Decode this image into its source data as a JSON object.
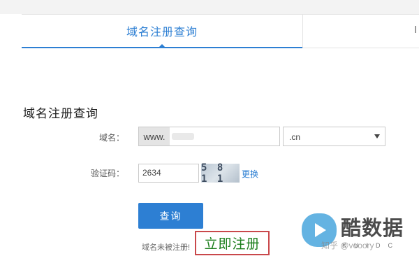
{
  "tabs": {
    "active_label": "域名注册查询",
    "second_label": ""
  },
  "form": {
    "title": "域名注册查询",
    "domain_label": "域名：",
    "domain_prefix": "www.",
    "domain_value": "",
    "suffix_value": ".cn",
    "captcha_label": "验证码：",
    "captcha_value": "2634",
    "captcha_image_text": "5811",
    "refresh_label": "更换",
    "query_button": "查询",
    "hint_text": "域名未被注册!",
    "register_label": "立即注册"
  },
  "watermark": {
    "brand": "酷数据",
    "sub": "KUIDC",
    "source": "知乎 @vooory"
  },
  "colors": {
    "accent": "#2d7fd3",
    "register_border": "#c9484b",
    "register_text": "#1a7d1a"
  }
}
